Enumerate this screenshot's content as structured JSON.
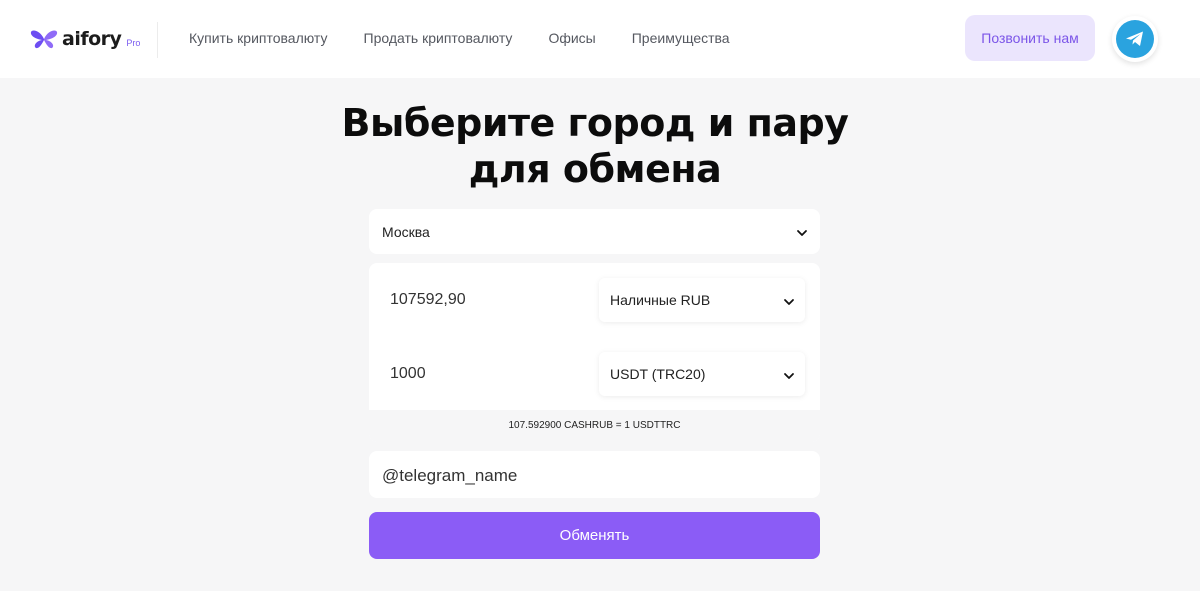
{
  "header": {
    "logo_text": "aifory",
    "logo_sub": "Pro",
    "nav": [
      "Купить криптовалюту",
      "Продать криптовалюту",
      "Офисы",
      "Преимущества"
    ],
    "call_label": "Позвонить нам",
    "telegram_icon": "telegram-icon"
  },
  "main": {
    "title_line1": "Выберите город и пару",
    "title_line2": "для обмена",
    "city": "Москва",
    "give_amount": "107592,90",
    "give_currency": "Наличные RUB",
    "get_amount": "1000",
    "get_currency": "USDT (TRC20)",
    "rate": "107.592900 CASHRUB = 1 USDTTRC",
    "telegram_placeholder": "@telegram_name",
    "submit_label": "Обменять"
  },
  "colors": {
    "accent": "#8b5cf6",
    "accent_light": "#ebe5fd",
    "telegram": "#2aa3df",
    "background": "#f6f6f7"
  }
}
